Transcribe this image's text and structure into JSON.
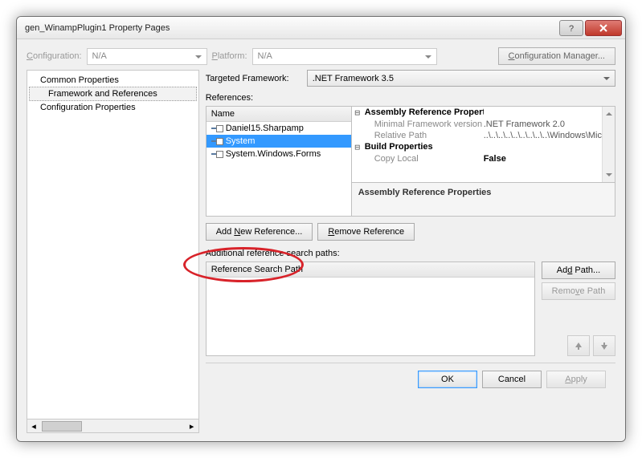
{
  "title": "gen_WinampPlugin1 Property Pages",
  "config": {
    "label": "Configuration:",
    "value": "N/A",
    "platform_label": "Platform:",
    "platform_value": "N/A",
    "mgr": "Configuration Manager..."
  },
  "tree": {
    "common": "Common Properties",
    "fw": "Framework and References",
    "cfg": "Configuration Properties"
  },
  "framework": {
    "label": "Targeted Framework:",
    "value": ".NET Framework 3.5"
  },
  "refs": {
    "label": "References:",
    "name_col": "Name",
    "items": [
      "Daniel15.Sharpamp",
      "System",
      "System.Windows.Forms"
    ]
  },
  "props": {
    "cat1": "Assembly Reference Properties",
    "minfw": "Minimal Framework version",
    "minfw_v": ".NET Framework 2.0",
    "relpath": "Relative Path",
    "relpath_v": "..\\..\\..\\..\\..\\..\\..\\..\\..\\Windows\\Mic",
    "cat2": "Build Properties",
    "copyl": "Copy Local",
    "copyl_v": "False",
    "desc": "Assembly Reference Properties"
  },
  "btns": {
    "addref": "Add New Reference...",
    "rmref": "Remove Reference"
  },
  "searchpaths": {
    "label": "Additional reference search paths:",
    "col": "Reference Search Path",
    "addpath": "Add Path...",
    "rmpath": "Remove Path"
  },
  "footer": {
    "ok": "OK",
    "cancel": "Cancel",
    "apply": "Apply"
  },
  "annot": {
    "n": "N",
    "c": "C",
    "p": "P",
    "a": "A",
    "r": "R",
    "d": "d",
    "v": "v"
  }
}
